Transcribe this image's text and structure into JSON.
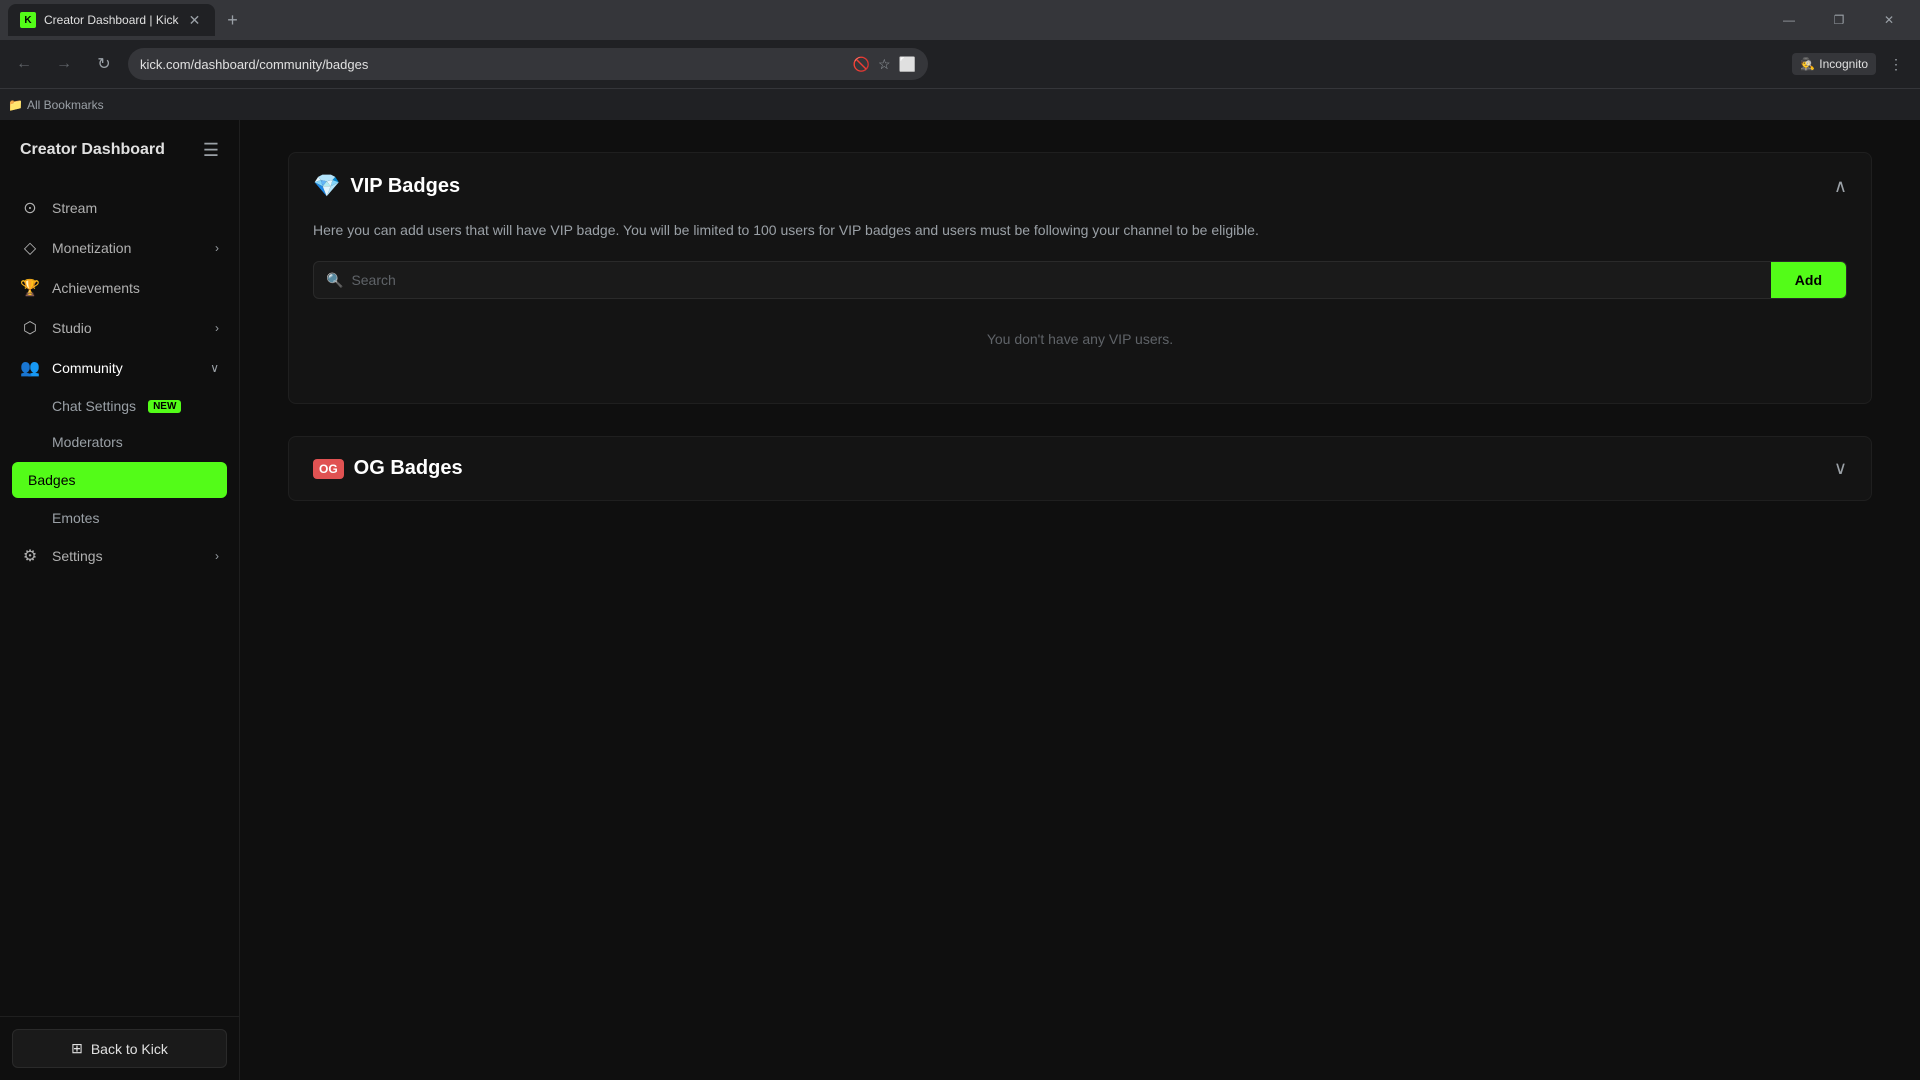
{
  "browser": {
    "tab_title": "Creator Dashboard | Kick",
    "tab_favicon": "K",
    "address": "kick.com/dashboard/community/badges",
    "profile_label": "Incognito",
    "bookmarks_label": "All Bookmarks",
    "new_tab_icon": "+",
    "close_icon": "✕",
    "minimize_icon": "—",
    "maximize_icon": "❐"
  },
  "sidebar": {
    "title": "Creator Dashboard",
    "menu_icon": "☰",
    "nav_items": [
      {
        "id": "stream",
        "label": "Stream",
        "icon": "⊙",
        "has_children": false
      },
      {
        "id": "monetization",
        "label": "Monetization",
        "icon": "◇",
        "has_children": true
      },
      {
        "id": "achievements",
        "label": "Achievements",
        "icon": "🏆",
        "has_children": false
      },
      {
        "id": "studio",
        "label": "Studio",
        "icon": "⬡",
        "has_children": true
      },
      {
        "id": "community",
        "label": "Community",
        "icon": "👥",
        "has_children": true,
        "expanded": true
      },
      {
        "id": "settings",
        "label": "Settings",
        "icon": "⚙",
        "has_children": true
      }
    ],
    "community_sub_items": [
      {
        "id": "chat-settings",
        "label": "Chat Settings",
        "badge": "NEW"
      },
      {
        "id": "moderators",
        "label": "Moderators"
      },
      {
        "id": "badges",
        "label": "Badges",
        "active": true
      },
      {
        "id": "emotes",
        "label": "Emotes"
      }
    ],
    "back_button_label": "Back to Kick",
    "back_button_icon": "⊞"
  },
  "main": {
    "vip_badges": {
      "title": "VIP Badges",
      "icon": "💎",
      "expanded": true,
      "description": "Here you can add users that will have VIP badge. You will be limited to 100 users for VIP badges and users must be following your channel to be eligible.",
      "search_placeholder": "Search",
      "add_button_label": "Add",
      "empty_message": "You don't have any VIP users.",
      "chevron": "∧"
    },
    "og_badges": {
      "title": "OG Badges",
      "icon": "🔴",
      "icon_label": "OG",
      "expanded": false,
      "chevron": "∨"
    }
  }
}
